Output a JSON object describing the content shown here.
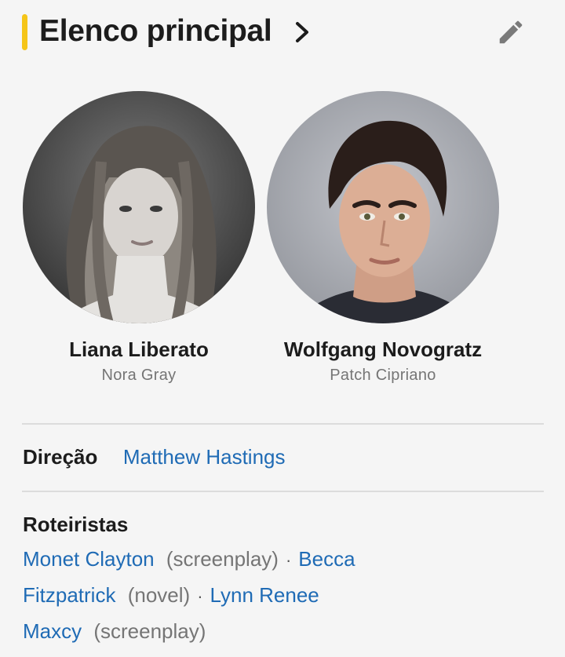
{
  "section": {
    "title": "Elenco principal",
    "accent_color": "#f5c518",
    "more_icon": "chevron-right-icon",
    "edit_icon": "pencil-icon"
  },
  "cast": [
    {
      "name": "Liana Liberato",
      "role": "Nora Gray"
    },
    {
      "name": "Wolfgang Novogratz",
      "role": "Patch Cipriano"
    }
  ],
  "direction": {
    "label": "Direção",
    "name": "Matthew Hastings"
  },
  "writers": {
    "label": "Roteiristas",
    "items": [
      {
        "name_part1": "Monet Clayton",
        "note": "(screenplay)"
      },
      {
        "name_part1": "Becca",
        "name_part2": "Fitzpatrick",
        "note": "(novel)"
      },
      {
        "name_part1": "Lynn Renee",
        "name_part2": "Maxcy",
        "note": "(screenplay)"
      }
    ],
    "separator": "·"
  },
  "link_color": "#1f6bb5"
}
